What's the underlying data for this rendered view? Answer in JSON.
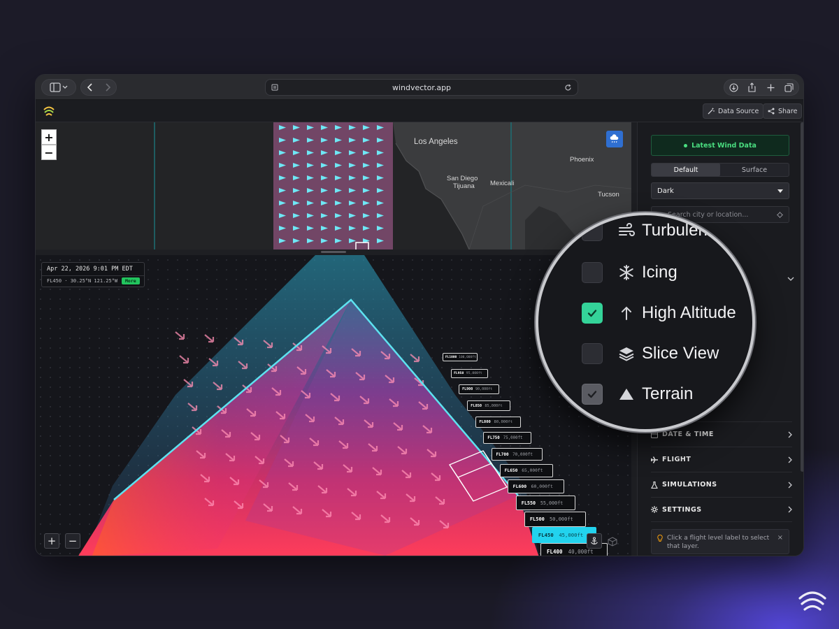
{
  "browser": {
    "url": "windvector.app"
  },
  "toolbar": {
    "data_source_label": "Data Source",
    "share_label": "Share"
  },
  "map": {
    "zoom_in": "+",
    "zoom_out": "−",
    "cities": [
      "Los Angeles",
      "Phoenix",
      "San Diego",
      "Tijuana",
      "Mexicali",
      "Tucson"
    ]
  },
  "viz": {
    "datetime": "Apr 22, 2026 9:01 PM EDT",
    "location": "FL450 · 30.25°N 121.25°W",
    "more_label": "More",
    "zoom_in": "+",
    "zoom_out": "−",
    "flight_levels": [
      {
        "label": "FL1000",
        "alt": "100,000ft"
      },
      {
        "label": "FL950",
        "alt": "95,000ft"
      },
      {
        "label": "FL900",
        "alt": "90,000ft"
      },
      {
        "label": "FL850",
        "alt": "85,000ft"
      },
      {
        "label": "FL800",
        "alt": "80,000ft"
      },
      {
        "label": "FL750",
        "alt": "75,000ft"
      },
      {
        "label": "FL700",
        "alt": "70,000ft"
      },
      {
        "label": "FL650",
        "alt": "65,000ft"
      },
      {
        "label": "FL600",
        "alt": "60,000ft"
      },
      {
        "label": "FL550",
        "alt": "55,000ft"
      },
      {
        "label": "FL500",
        "alt": "50,000ft"
      },
      {
        "label": "FL450",
        "alt": "45,000ft"
      },
      {
        "label": "FL400",
        "alt": "40,000ft"
      }
    ],
    "selected_level": "FL450"
  },
  "sidebar": {
    "latest_label": "Latest Wind Data",
    "mode_tabs": [
      "Default",
      "Surface"
    ],
    "active_mode": "Default",
    "theme_value": "Dark",
    "search_placeholder": "Search city or location...",
    "nav": [
      {
        "label": "DATE & TIME",
        "icon": "calendar-icon"
      },
      {
        "label": "FLIGHT",
        "icon": "plane-icon"
      },
      {
        "label": "SIMULATIONS",
        "icon": "flask-icon"
      },
      {
        "label": "SETTINGS",
        "icon": "gear-icon"
      }
    ],
    "hint": "Click a flight level label to select that layer."
  },
  "layers": [
    {
      "label": "Turbulence",
      "icon": "wind-icon",
      "state": "off"
    },
    {
      "label": "Icing",
      "icon": "snowflake-icon",
      "state": "off"
    },
    {
      "label": "High Altitude",
      "icon": "arrow-up-icon",
      "state": "on"
    },
    {
      "label": "Slice View",
      "icon": "layers-icon",
      "state": "off"
    },
    {
      "label": "Terrain",
      "icon": "mountain-icon",
      "state": "on-muted"
    }
  ],
  "colors": {
    "accent_green": "#34d399",
    "selected_level": "#22d3ee",
    "brand_glow": "#5346d6"
  }
}
